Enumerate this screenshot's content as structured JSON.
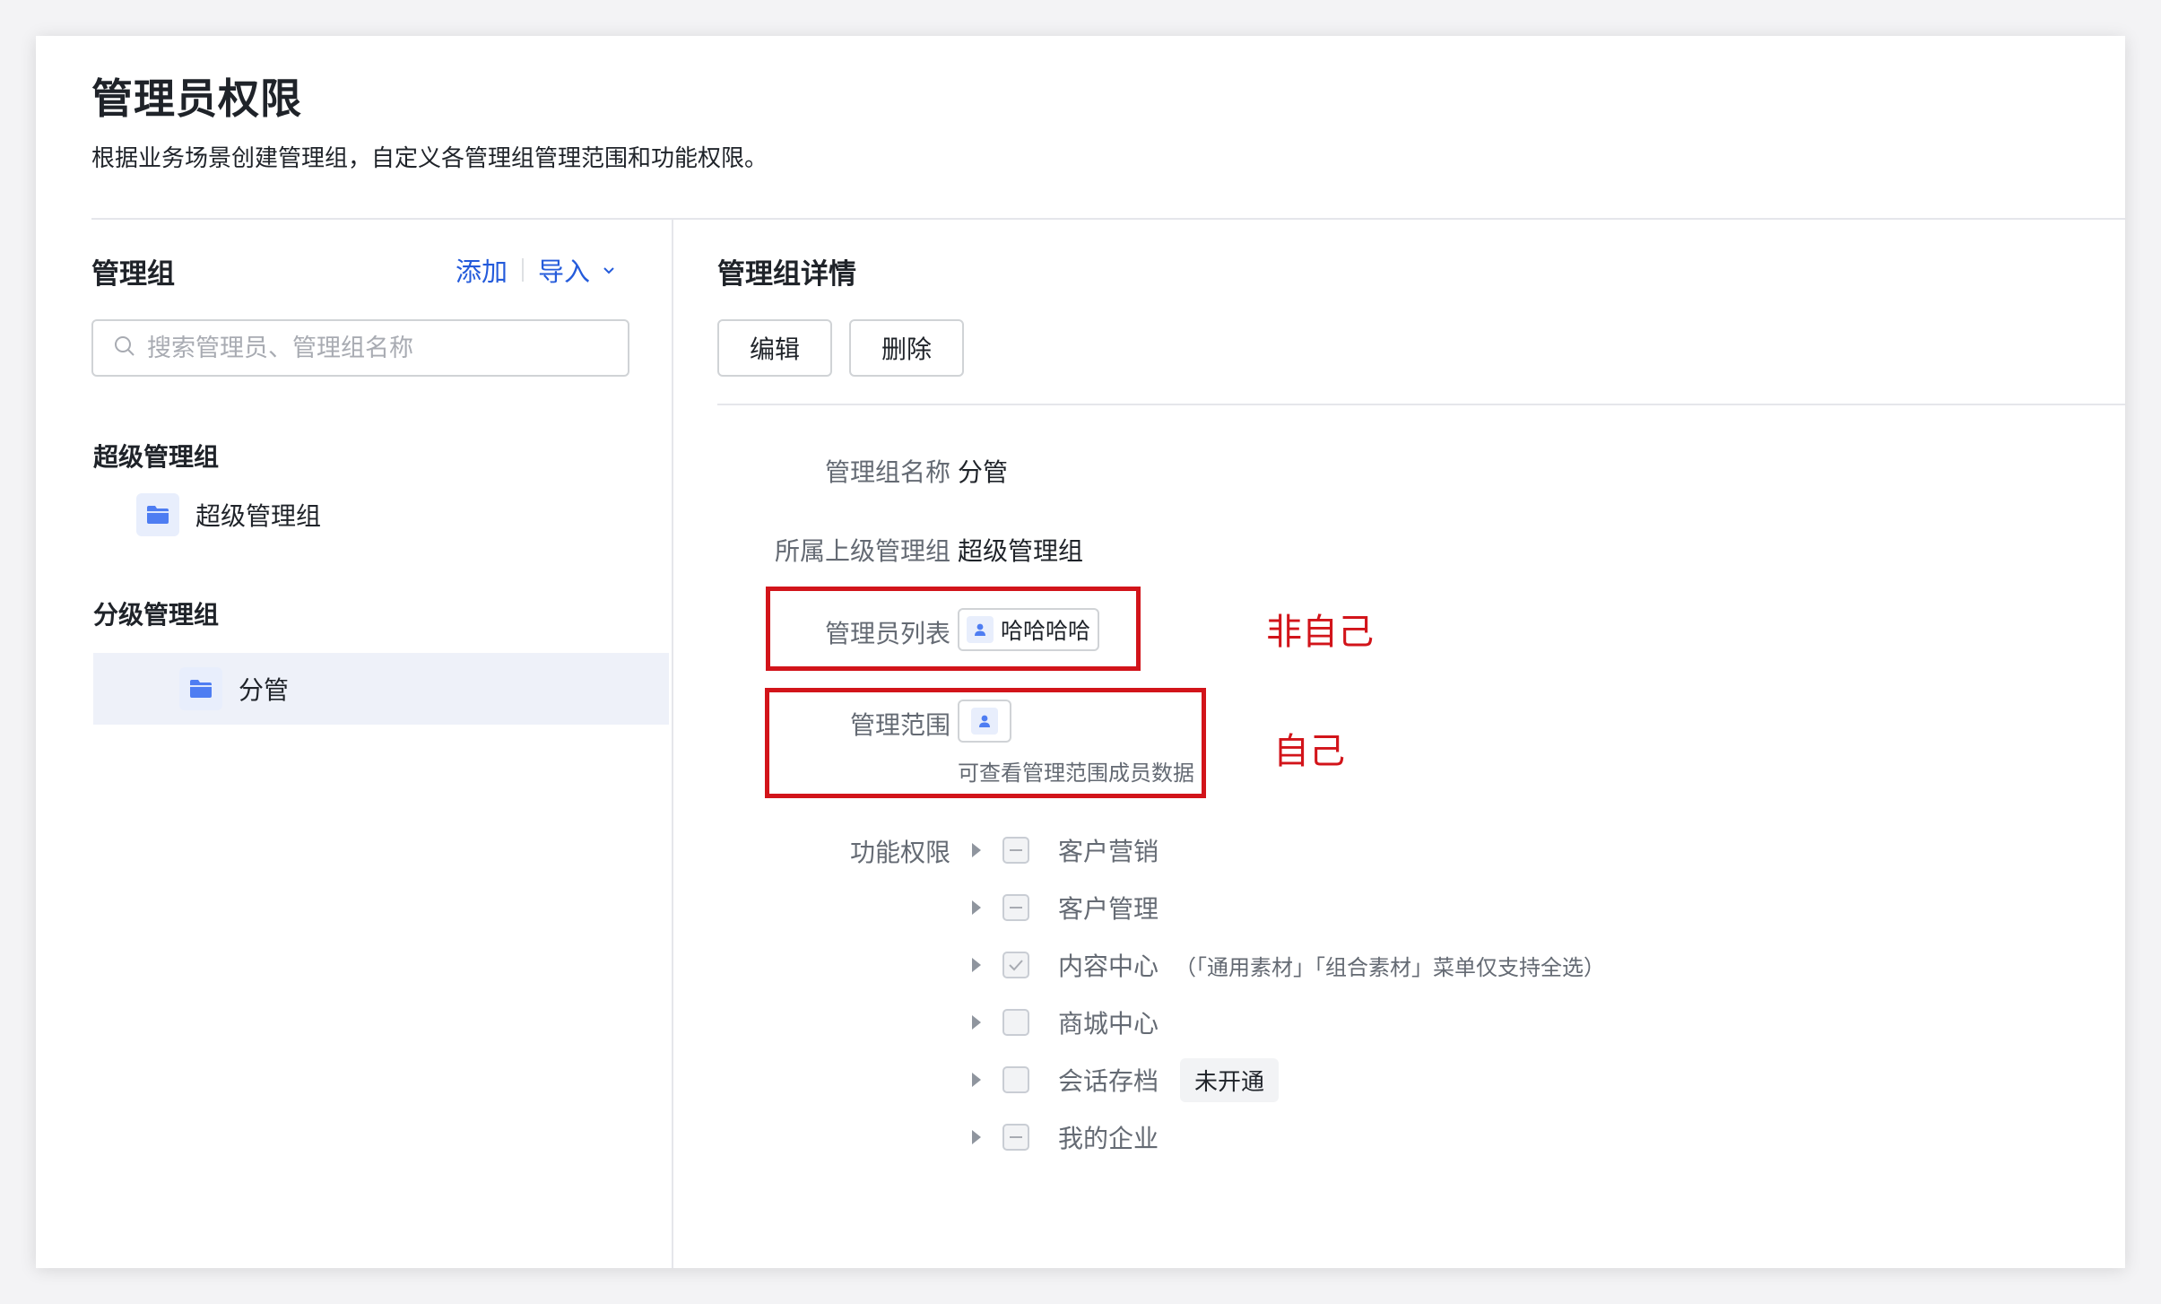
{
  "page": {
    "title": "管理员权限",
    "description": "根据业务场景创建管理组，自定义各管理组管理范围和功能权限。"
  },
  "left": {
    "title": "管理组",
    "add_label": "添加",
    "import_label": "导入",
    "search_placeholder": "搜索管理员、管理组名称",
    "sections": [
      {
        "label": "超级管理组",
        "items": [
          {
            "label": "超级管理组"
          }
        ]
      },
      {
        "label": "分级管理组",
        "items": [
          {
            "label": "分管",
            "selected": true
          }
        ]
      }
    ]
  },
  "right": {
    "title": "管理组详情",
    "edit_label": "编辑",
    "delete_label": "删除",
    "fields": {
      "name_label": "管理组名称",
      "name_value": "分管",
      "parent_label": "所属上级管理组",
      "parent_value": "超级管理组",
      "admins_label": "管理员列表",
      "admin_tag": "哈哈哈哈",
      "scope_label": "管理范围",
      "scope_note": "可查看管理范围成员数据",
      "perm_label": "功能权限"
    },
    "permissions": [
      {
        "label": "客户营销",
        "state": "indeterminate",
        "note": "",
        "badge": ""
      },
      {
        "label": "客户管理",
        "state": "indeterminate",
        "note": "",
        "badge": ""
      },
      {
        "label": "内容中心",
        "state": "checked",
        "note": "（「通用素材」「组合素材」菜单仅支持全选）",
        "badge": ""
      },
      {
        "label": "商城中心",
        "state": "unchecked",
        "note": "",
        "badge": ""
      },
      {
        "label": "会话存档",
        "state": "unchecked",
        "note": "",
        "badge": "未开通"
      },
      {
        "label": "我的企业",
        "state": "indeterminate",
        "note": "",
        "badge": ""
      }
    ]
  },
  "annotations": {
    "not_self": "非自己",
    "self": "自己"
  },
  "colors": {
    "accent": "#245bdb",
    "annotation_red": "#d2141a",
    "selected_bg": "#eef1f9"
  }
}
